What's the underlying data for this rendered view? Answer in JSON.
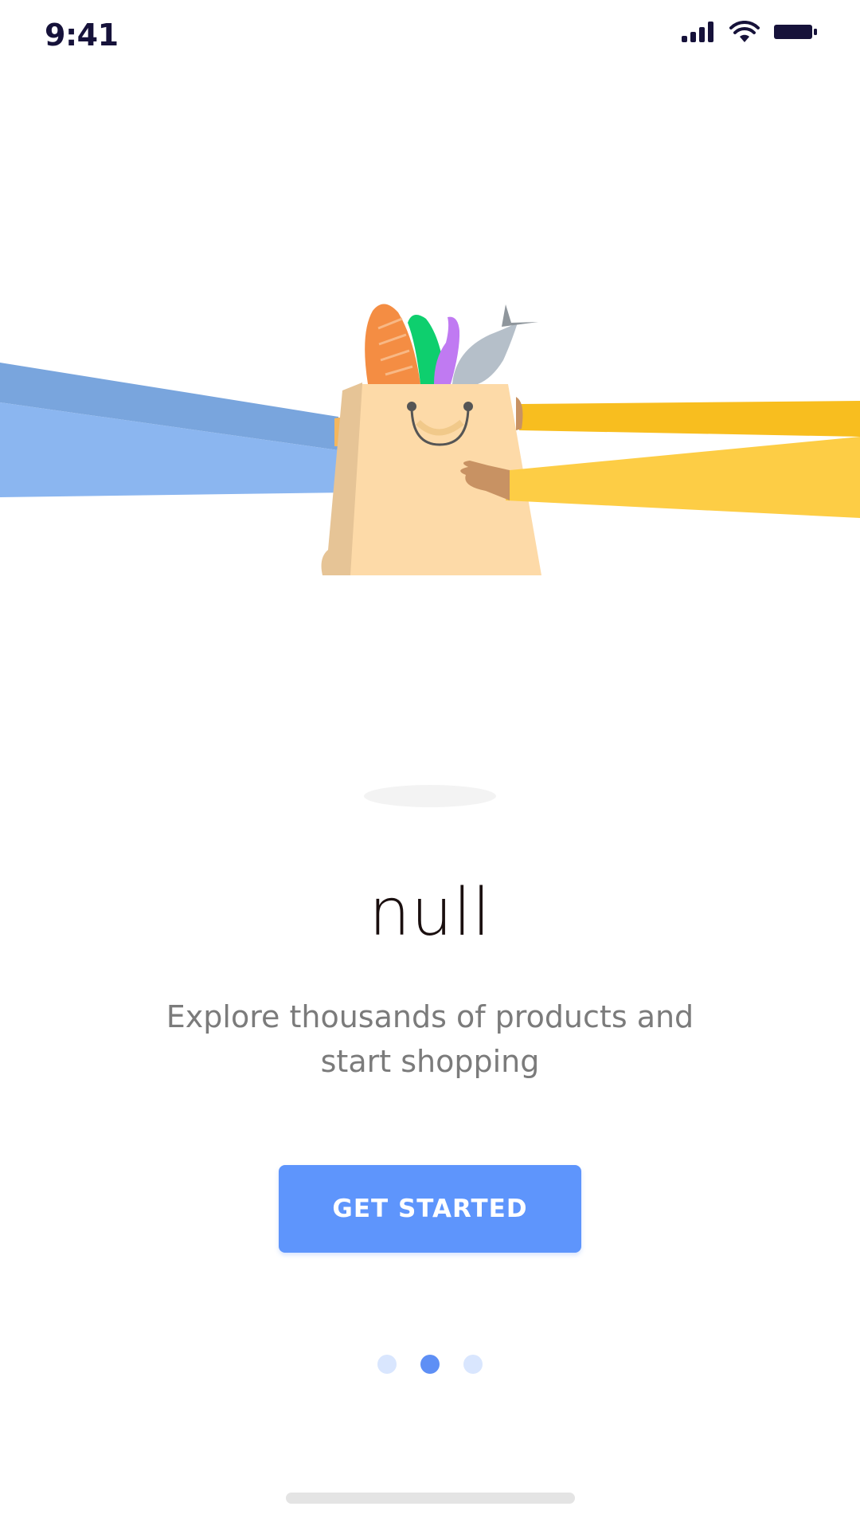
{
  "status_bar": {
    "time": "9:41",
    "icons": [
      "cellular-signal-icon",
      "wifi-icon",
      "battery-icon"
    ]
  },
  "illustration": {
    "name": "grocery-bag-handoff-illustration",
    "colors": {
      "left_arm_upper": "#79a5dd",
      "left_arm_lower": "#8bb6f0",
      "right_arm_upper": "#f8be1f",
      "right_arm_lower": "#fdcd45",
      "bag_front": "#fddaa8",
      "bag_side": "#e6c496",
      "baguette": "#f48d43",
      "leek": "#0ecf6e",
      "eggplant": "#c07af2",
      "fish": "#b5bfc9"
    }
  },
  "onboarding": {
    "title": "null",
    "subtitle_line1": "Explore thousands of products and",
    "subtitle_line2": "start shopping",
    "cta_label": "GET STARTED"
  },
  "pager": {
    "total_pages": 3,
    "active_index": 1
  },
  "theme": {
    "accent": "#5e95fc",
    "title_color": "#1a0f0f",
    "subtitle_color": "#7b7b7b"
  }
}
